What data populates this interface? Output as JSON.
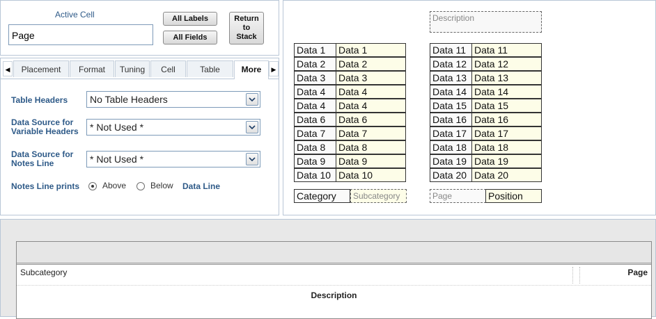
{
  "active_cell": {
    "label": "Active Cell",
    "value": "Page",
    "all_labels": "All Labels",
    "all_fields": "All Fields",
    "return_to_stack": [
      "Return",
      "to",
      "Stack"
    ]
  },
  "tabs": [
    "Placement",
    "Format",
    "Tuning",
    "Cell",
    "Table",
    "More"
  ],
  "active_tab": "More",
  "settings": {
    "table_headers_label": "Table Headers",
    "table_headers_value": "No Table Headers",
    "var_headers_label": [
      "Data Source for",
      "Variable Headers"
    ],
    "var_headers_value": "* Not Used *",
    "notes_line_label": [
      "Data Source for",
      "Notes Line"
    ],
    "notes_line_value": "* Not Used *",
    "notes_prints_label": "Notes Line prints",
    "above": "Above",
    "below": "Below",
    "data_line": "Data Line"
  },
  "preview": {
    "description": "Description",
    "left_table": [
      [
        "Data 1",
        "Data 1"
      ],
      [
        "Data 2",
        "Data 2"
      ],
      [
        "Data 3",
        "Data 3"
      ],
      [
        "Data 4",
        "Data 4"
      ],
      [
        "Data 4",
        "Data 4"
      ],
      [
        "Data 6",
        "Data 6"
      ],
      [
        "Data 7",
        "Data 7"
      ],
      [
        "Data 8",
        "Data 8"
      ],
      [
        "Data 9",
        "Data 9"
      ],
      [
        "Data 10",
        "Data 10"
      ]
    ],
    "right_table": [
      [
        "Data 11",
        "Data 11"
      ],
      [
        "Data 12",
        "Data 12"
      ],
      [
        "Data 13",
        "Data 13"
      ],
      [
        "Data 14",
        "Data 14"
      ],
      [
        "Data 15",
        "Data 15"
      ],
      [
        "Data 16",
        "Data 16"
      ],
      [
        "Data 17",
        "Data 17"
      ],
      [
        "Data 18",
        "Data 18"
      ],
      [
        "Data 19",
        "Data 19"
      ],
      [
        "Data 20",
        "Data 20"
      ]
    ],
    "category": "Category",
    "subcategory": "Subcategory",
    "page": "Page",
    "position": "Position"
  },
  "bottom": {
    "subcategory": "Subcategory",
    "page": "Page",
    "description": "Description"
  }
}
